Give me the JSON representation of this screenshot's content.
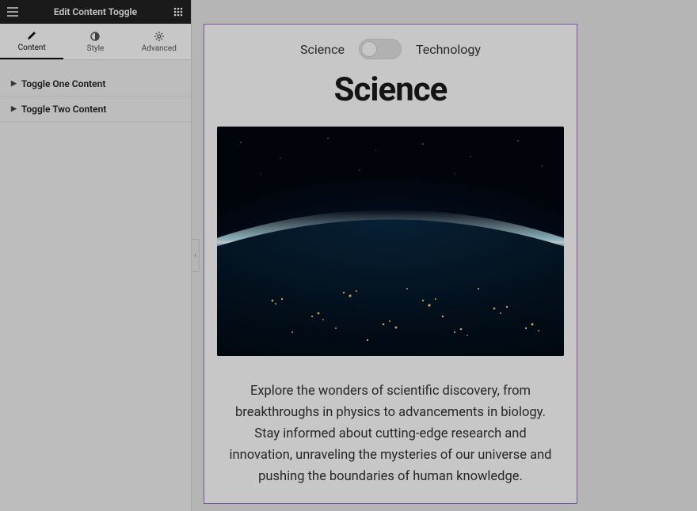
{
  "sidebar": {
    "title": "Edit Content Toggle",
    "tabs": {
      "content": "Content",
      "style": "Style",
      "advanced": "Advanced"
    },
    "accordion": {
      "one": "Toggle One Content",
      "two": "Toggle Two Content"
    }
  },
  "widget": {
    "toggle": {
      "left_label": "Science",
      "right_label": "Technology",
      "state": "left"
    },
    "heading": "Science",
    "image": {
      "alt": "earth-from-space-night",
      "icon": "globe-icon"
    },
    "paragraph": "Explore the wonders of scientific discovery, from breakthroughs in physics to advancements in biology. Stay informed about cutting-edge research and innovation, unraveling the mysteries of our universe and pushing the boundaries of human knowledge."
  },
  "collapse_handle": "‹"
}
